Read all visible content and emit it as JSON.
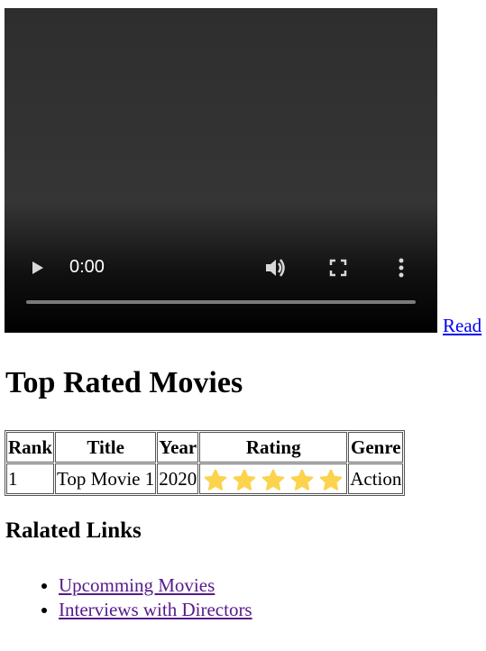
{
  "video": {
    "time": "0:00",
    "progress": 0,
    "controls": [
      "play-icon",
      "volume-icon",
      "fullscreen-icon",
      "more-options-icon"
    ]
  },
  "read_link": "Read",
  "heading": "Top Rated Movies",
  "table": {
    "headers": [
      "Rank",
      "Title",
      "Year",
      "Rating",
      "Genre"
    ],
    "rows": [
      {
        "rank": "1",
        "title": "Top Movie 1",
        "year": "2020",
        "rating_stars": 5,
        "genre": "Action"
      }
    ]
  },
  "links_heading": "Ralated Links",
  "links": [
    "Upcomming Movies",
    "Interviews with Directors"
  ],
  "colors": {
    "star": "#fcd34d",
    "link": "#0000ee",
    "visited_link": "#551a8b"
  }
}
